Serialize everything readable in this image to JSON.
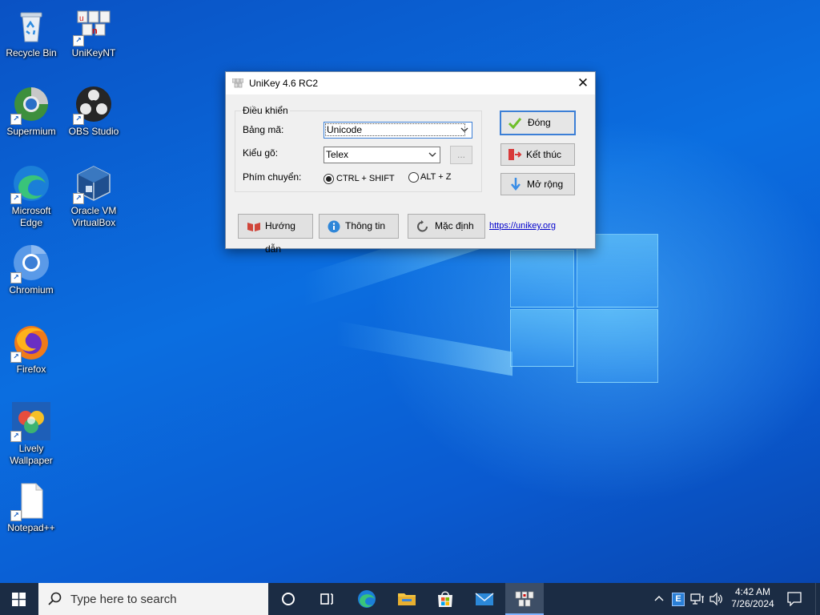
{
  "desktop_icons": [
    {
      "label": "Recycle Bin",
      "icon": "recycle-bin-icon"
    },
    {
      "label": "UniKeyNT",
      "icon": "unikey-icon"
    },
    {
      "label": "Supermium",
      "icon": "supermium-icon"
    },
    {
      "label": "OBS Studio",
      "icon": "obs-icon"
    },
    {
      "label": "Microsoft Edge",
      "icon": "edge-icon"
    },
    {
      "label": "Oracle VM VirtualBox",
      "icon": "virtualbox-icon"
    },
    {
      "label": "Chromium",
      "icon": "chromium-icon"
    },
    {
      "label": "Firefox",
      "icon": "firefox-icon"
    },
    {
      "label": "Lively Wallpaper",
      "icon": "lively-wallpaper-icon"
    },
    {
      "label": "Notepad++",
      "icon": "notepadpp-icon"
    }
  ],
  "dialog": {
    "title": "UniKey 4.6 RC2",
    "group_title": "Điều khiển",
    "charset_label": "Bảng mã:",
    "charset_value": "Unicode",
    "input_label": "Kiểu gõ:",
    "input_value": "Telex",
    "more_button": "...",
    "switch_label": "Phím chuyển:",
    "switch_options": [
      "CTRL + SHIFT",
      "ALT + Z"
    ],
    "switch_selected": "CTRL + SHIFT",
    "buttons": {
      "close": "Đóng",
      "exit": "Kết thúc",
      "expand": "Mở rộng",
      "help": "Hướng dẫn",
      "info": "Thông tin",
      "default": "Mặc định"
    },
    "link": "https://unikey.org"
  },
  "taskbar": {
    "search_placeholder": "Type here to search",
    "time": "4:42 AM",
    "date": "7/26/2024",
    "apps": [
      "task-view",
      "edge",
      "file-explorer",
      "microsoft-store",
      "mail",
      "unikey"
    ]
  },
  "colors": {
    "taskbar": "#1b2c44",
    "desktop": "#0b6ee0",
    "link": "#0000cc"
  }
}
